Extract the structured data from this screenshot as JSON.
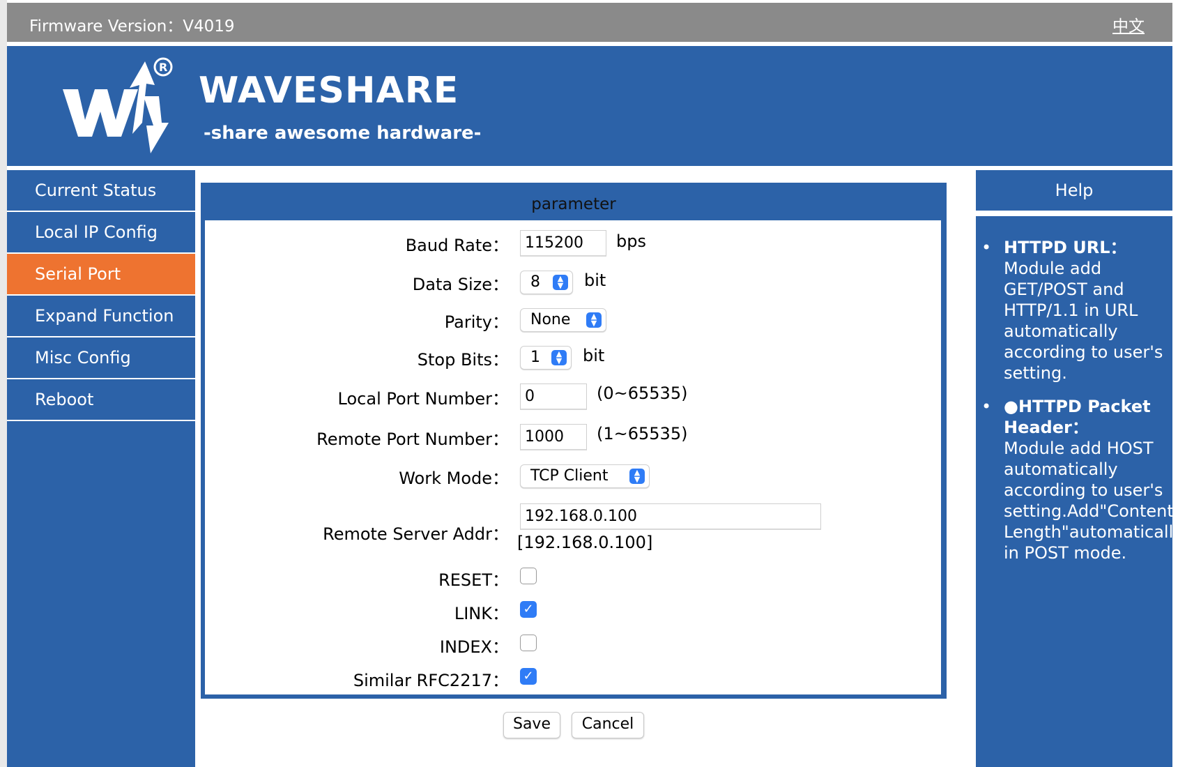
{
  "topbar": {
    "firmware": "Firmware Version：V4019",
    "language_link": "中文"
  },
  "header": {
    "brand": "WAVESHARE",
    "slogan": "-share awesome hardware-"
  },
  "sidebar": {
    "items": [
      {
        "label": "Current Status"
      },
      {
        "label": "Local IP Config"
      },
      {
        "label": "Serial Port"
      },
      {
        "label": "Expand Function"
      },
      {
        "label": "Misc Config"
      },
      {
        "label": "Reboot"
      }
    ],
    "active_index": 2
  },
  "panel": {
    "title": "parameter",
    "baud_rate": {
      "label": "Baud Rate：",
      "value": "115200",
      "unit": "bps"
    },
    "data_size": {
      "label": "Data Size：",
      "value": "8",
      "unit": "bit"
    },
    "parity": {
      "label": "Parity：",
      "value": "None"
    },
    "stop_bits": {
      "label": "Stop Bits：",
      "value": "1",
      "unit": "bit"
    },
    "local_port": {
      "label": "Local Port Number：",
      "value": "0",
      "range": "(0~65535)"
    },
    "remote_port": {
      "label": "Remote Port Number：",
      "value": "1000",
      "range": "(1~65535)"
    },
    "work_mode": {
      "label": "Work Mode：",
      "value": "TCP Client"
    },
    "remote_server": {
      "label": "Remote Server Addr：",
      "value": "192.168.0.100",
      "resolved": "[192.168.0.100]"
    },
    "reset": {
      "label": "RESET：",
      "checked": false
    },
    "link": {
      "label": "LINK：",
      "checked": true
    },
    "index": {
      "label": "INDEX：",
      "checked": false
    },
    "rfc2217": {
      "label": "Similar RFC2217：",
      "checked": true
    }
  },
  "buttons": {
    "save": "Save",
    "cancel": "Cancel"
  },
  "help": {
    "title": "Help",
    "item1": {
      "heading": "HTTPD URL",
      "colon": "：",
      "text": "Module add GET/POST and HTTP/1.1 in URL automatically according to user's setting."
    },
    "item2": {
      "heading": "●HTTPD Packet Header",
      "colon": "：",
      "text": "Module add HOST automatically according to user's setting.Add\"Content Length\"automatically in POST mode."
    }
  },
  "colors": {
    "brand_blue": "#2c62a8",
    "active_orange": "#ee7330",
    "topbar_gray": "#8a8a8a",
    "control_blue": "#2f7cf6"
  }
}
